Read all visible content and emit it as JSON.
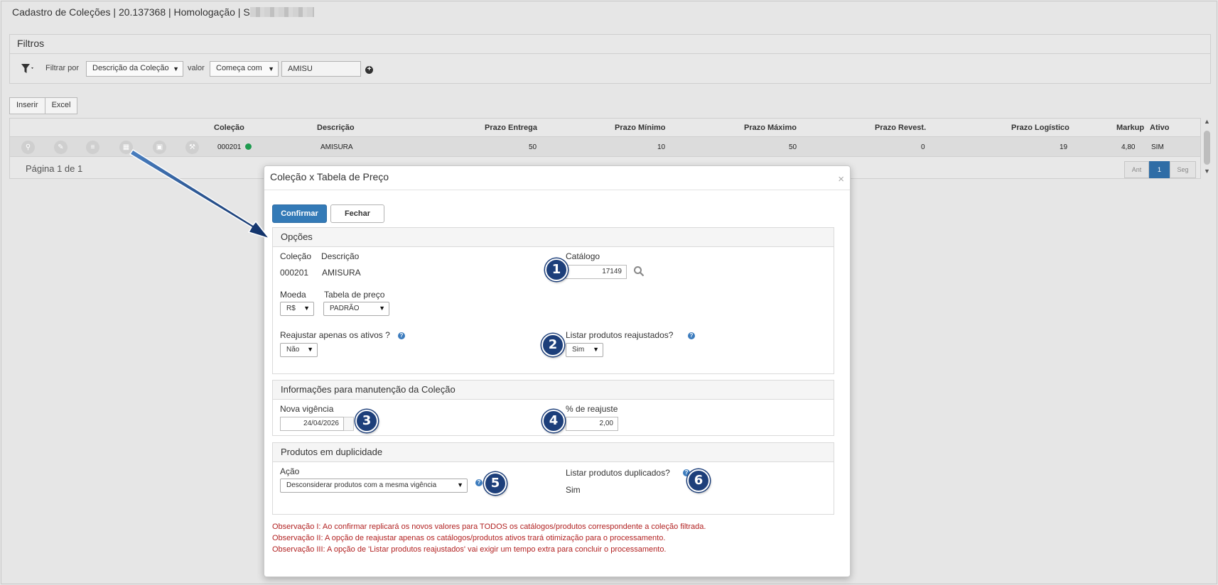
{
  "app": {
    "title": "Cadastro de Coleções | 20.137368 | Homologação | S"
  },
  "filters": {
    "title": "Filtros",
    "filter_by_label": "Filtrar por",
    "field_selected": "Descrição da Coleção",
    "value_label": "valor",
    "operator_selected": "Começa com",
    "value": "AMISU"
  },
  "actions": {
    "insert": "Inserir",
    "excel": "Excel"
  },
  "grid": {
    "columns": [
      "Coleção",
      "Descrição",
      "Prazo Entrega",
      "Prazo Mínimo",
      "Prazo Máximo",
      "Prazo Revest.",
      "Prazo Logístico",
      "Markup",
      "Ativo"
    ],
    "row": {
      "colecao": "000201",
      "descricao": "AMISURA",
      "prazo_entrega": "50",
      "prazo_minimo": "10",
      "prazo_maximo": "50",
      "prazo_revest": "0",
      "prazo_logistico": "19",
      "markup": "4,80",
      "ativo": "SIM",
      "status_color": "#1e9b4f"
    },
    "row_icons": [
      "search-icon",
      "edit-icon",
      "list-icon",
      "table-icon",
      "money-icon",
      "wrench-icon"
    ],
    "pager": {
      "label": "Página 1 de 1",
      "prev": "Ant",
      "current": "1",
      "next": "Seg"
    }
  },
  "modal": {
    "title": "Coleção x Tabela de Preço",
    "close": "×",
    "confirm": "Confirmar",
    "close_button": "Fechar",
    "opcoes": {
      "title": "Opções",
      "colecao_label": "Coleção",
      "colecao_value": "000201",
      "descricao_label": "Descrição",
      "descricao_value": "AMISURA",
      "catalogo_label": "Catálogo",
      "catalogo_value": "17149",
      "moeda_label": "Moeda",
      "moeda_value": "R$",
      "tabela_label": "Tabela de preço",
      "tabela_value": "PADRÃO",
      "reajustar_label": "Reajustar apenas os ativos ?",
      "reajustar_value": "Não",
      "listar_reaj_label": "Listar produtos reajustados?",
      "listar_reaj_value": "Sim"
    },
    "manutencao": {
      "title": "Informações para manutenção da Coleção",
      "vigencia_label": "Nova vigência",
      "vigencia_value": "24/04/2026",
      "reajuste_label": "% de reajuste",
      "reajuste_value": "2,00"
    },
    "duplicidade": {
      "title": "Produtos em duplicidade",
      "acao_label": "Ação",
      "acao_value": "Desconsiderar produtos com a mesma vigência",
      "listar_dup_label": "Listar produtos duplicados?",
      "listar_dup_value": "Sim"
    },
    "notes": [
      "Observação I: Ao confirmar replicará os novos valores para TODOS os catálogos/produtos correspondente a coleção filtrada.",
      "Observação II: A opção de reajustar apenas os catálogos/produtos ativos trará otimização para o processamento.",
      "Observação III: A opção de 'Listar produtos reajustados' vai exigir um tempo extra para concluir o processamento."
    ]
  },
  "callouts": [
    "1",
    "2",
    "3",
    "4",
    "5",
    "6"
  ],
  "colors": {
    "primary": "#337ab7",
    "callout": "#1d3f7a",
    "note": "#b22222",
    "arrow": "#1d3f7a"
  }
}
